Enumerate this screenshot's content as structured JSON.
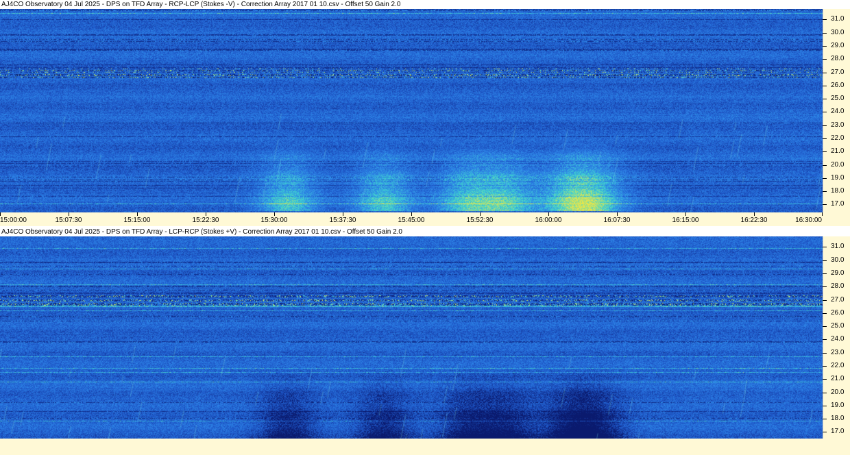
{
  "panels": [
    {
      "title": "AJ4CO Observatory 04 Jul 2025  -  DPS on TFD Array  -  RCP-LCP (Stokes -V)  -  Correction Array 2017 01 10.csv  -  Offset 50  Gain 2.0",
      "burst": "light"
    },
    {
      "title": "AJ4CO Observatory 04 Jul 2025  -  DPS on TFD Array  -  LCP-RCP (Stokes +V)  -  Correction Array 2017 01 10.csv  -  Offset 50  Gain 2.0",
      "burst": "dark"
    }
  ],
  "chart_data": [
    {
      "type": "heatmap",
      "title": "AJ4CO Observatory 04 Jul 2025  -  DPS on TFD Array  -  RCP-LCP (Stokes -V)  -  Correction Array 2017 01 10.csv  -  Offset 50  Gain 2.0",
      "x_ticks": [
        "15:00:00",
        "15:07:30",
        "15:15:00",
        "15:22:30",
        "15:30:00",
        "15:37:30",
        "15:45:00",
        "15:52:30",
        "16:00:00",
        "16:07:30",
        "16:15:00",
        "16:22:30",
        "16:30:00"
      ],
      "xlim": [
        "15:00:00",
        "16:30:00"
      ],
      "y_ticks": [
        "31.0",
        "30.0",
        "29.0",
        "28.0",
        "27.0",
        "26.0",
        "25.0",
        "24.0",
        "23.0",
        "22.0",
        "21.0",
        "20.0",
        "19.0",
        "18.0",
        "17.0"
      ],
      "ylim": [
        16.4,
        31.8
      ],
      "colormap": [
        "#0a1a6e",
        "#1e57c8",
        "#2e86e8",
        "#3fd4d0",
        "#e8e64a"
      ]
    },
    {
      "type": "heatmap",
      "title": "AJ4CO Observatory 04 Jul 2025  -  DPS on TFD Array  -  LCP-RCP (Stokes +V)  -  Correction Array 2017 01 10.csv  -  Offset 50  Gain 2.0",
      "x_ticks": [],
      "xlim": [
        "15:00:00",
        "16:30:00"
      ],
      "y_ticks": [
        "31.0",
        "30.0",
        "29.0",
        "28.0",
        "27.0",
        "26.0",
        "25.0",
        "24.0",
        "23.0",
        "22.0",
        "21.0",
        "20.0",
        "19.0",
        "18.0",
        "17.0"
      ],
      "ylim": [
        16.4,
        31.8
      ],
      "colormap": [
        "#0a1a6e",
        "#1e57c8",
        "#2e86e8",
        "#3fd4d0",
        "#e8e64a"
      ]
    }
  ]
}
